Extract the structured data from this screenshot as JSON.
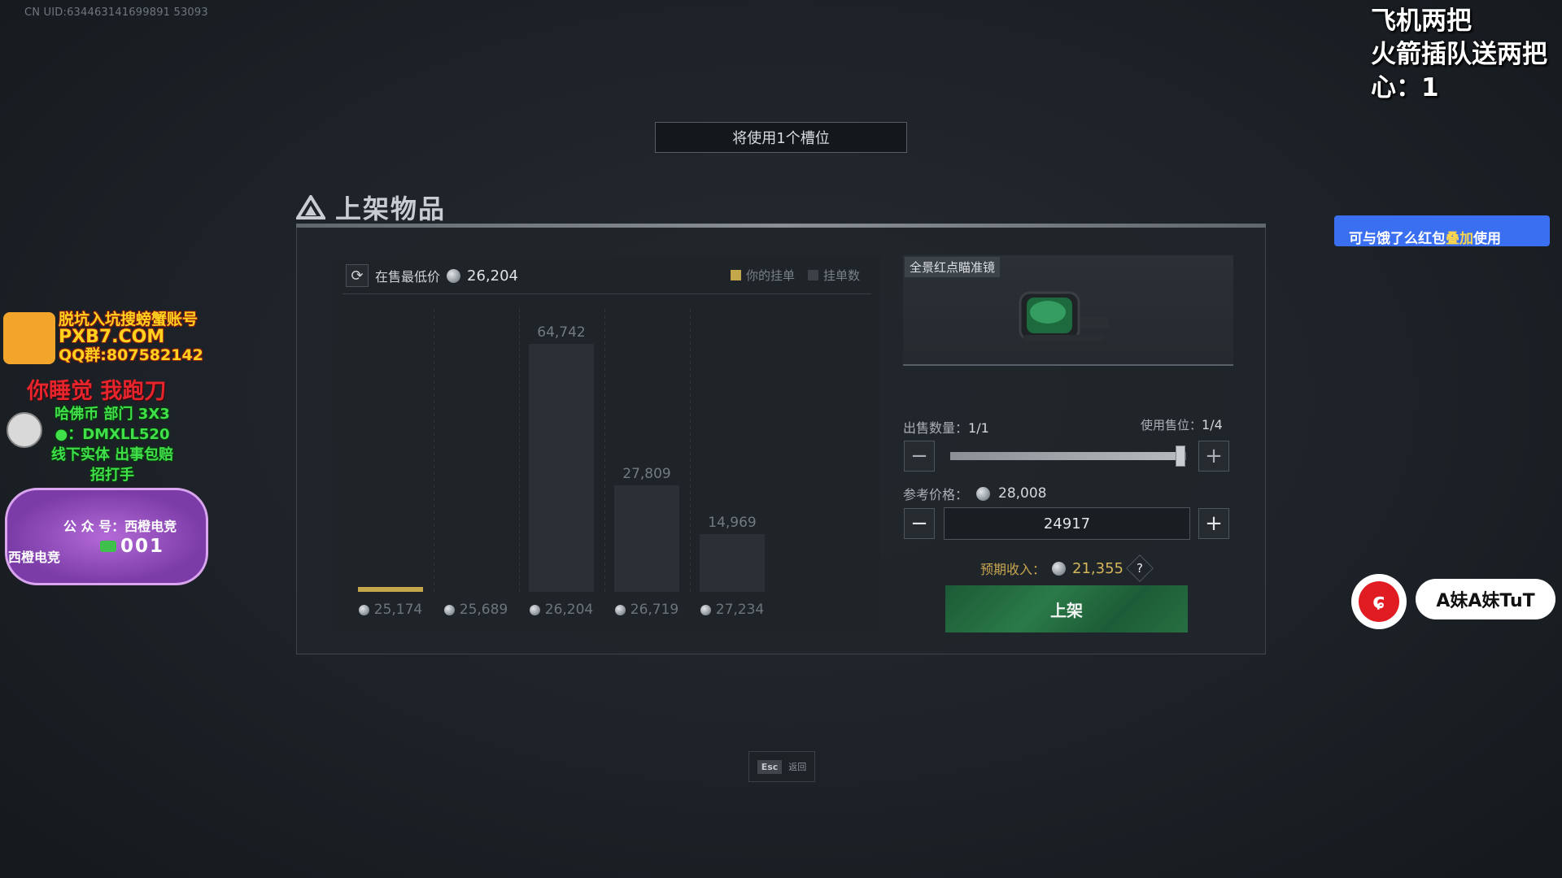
{
  "uid": "CN UID:634463141699891 53093",
  "overlay_top_right": {
    "line1": "飞机两把",
    "line2": "火箭插队送两把",
    "line3": "心：1"
  },
  "slot_banner": "将使用1个槽位",
  "panel_title": "上架物品",
  "chart_header": {
    "lowest_label": "在售最低价",
    "lowest_value": "26,204",
    "legend_mine": "你的挂单",
    "legend_count": "挂单数"
  },
  "colors": {
    "mine": "#c4a64b",
    "count": "#3b4147",
    "list_button": "#2a7a48",
    "expected": "#d6b65a"
  },
  "chart_data": {
    "type": "bar",
    "categories": [
      "25,174",
      "25,689",
      "26,204",
      "26,719",
      "27,234"
    ],
    "series": [
      {
        "name": "挂单数",
        "values": [
          null,
          null,
          64742,
          27809,
          14969
        ]
      }
    ],
    "value_labels": [
      "",
      "",
      "64,742",
      "27,809",
      "14,969"
    ],
    "mine_index": 0,
    "ylim": [
      0,
      70000
    ],
    "legend": [
      "你的挂单",
      "挂单数"
    ],
    "legend_position": "top-right",
    "title": "",
    "xlabel": "",
    "ylabel": ""
  },
  "item": {
    "name": "全景红点瞄准镜"
  },
  "sell": {
    "quantity_label": "出售数量：",
    "quantity_value": "1/1",
    "slots_label": "使用售位：",
    "slots_value": "1/4",
    "quantity_fraction": 1.0,
    "ref_price_label": "参考价格：",
    "ref_price_value": "28,008",
    "price_input": "24917",
    "expected_label": "预期收入：",
    "expected_value": "21,355",
    "help": "?",
    "list_button": "上架",
    "minus": "−",
    "plus": "+"
  },
  "esc": {
    "key": "Esc",
    "label": "返回"
  },
  "left_overlay": {
    "ad_line1": "脱坑入坑搜螃蟹账号",
    "ad_line2": "PXB7.COM",
    "ad_line3": "QQ群:807582142",
    "red_slogan": "你睡觉 我跑刀",
    "green_line1": "哈佛币 部门 3X3",
    "green_line2": "：DMXLL520",
    "green_line3": "线下实体 出事包赔",
    "green_line4": "招打手",
    "sticker_account": "公 众 号：西橙电竞",
    "sticker_code": "001",
    "sticker_brand": "西橙电竞"
  },
  "right_overlay": {
    "promo_pre": "可与饿了么红包",
    "promo_hl": "叠加",
    "promo_post": "使用",
    "handle": "A妹A妹TuT"
  }
}
